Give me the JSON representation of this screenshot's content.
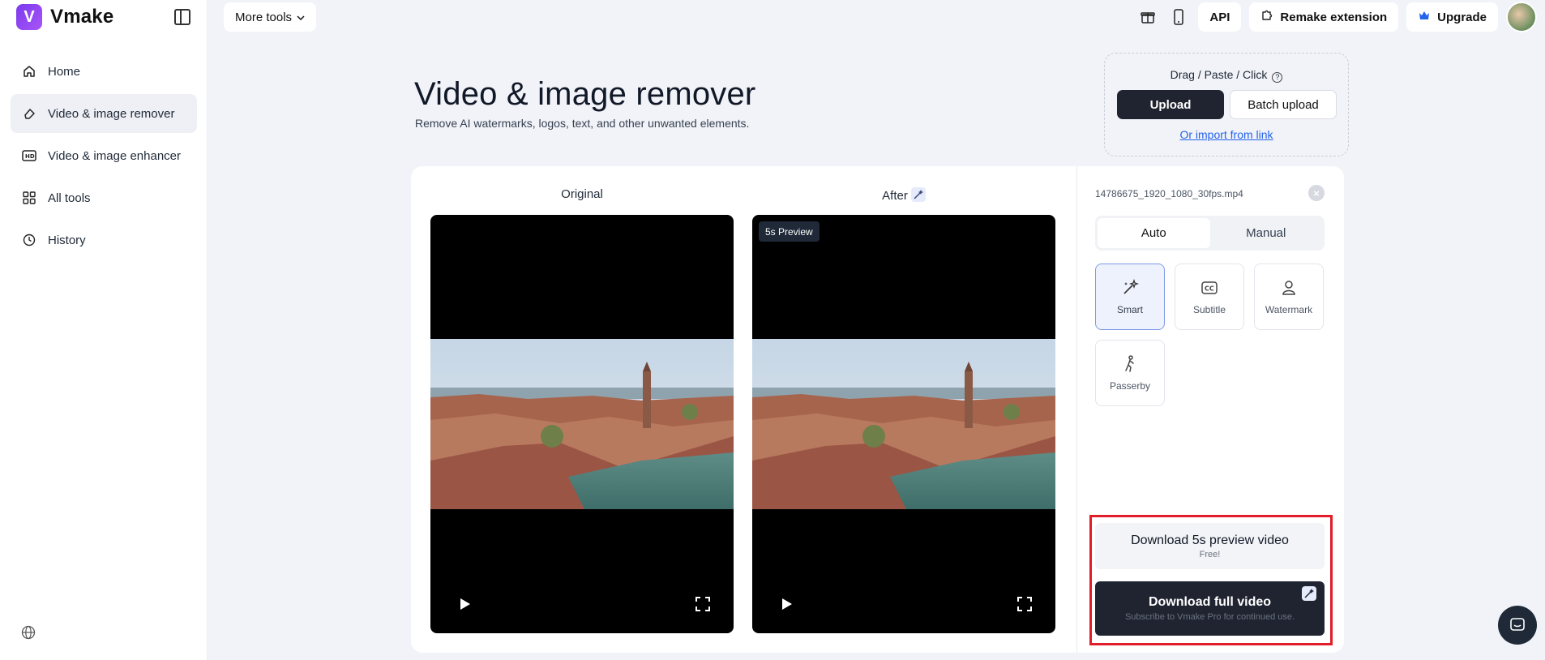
{
  "app": {
    "name": "Vmake"
  },
  "sidebar": {
    "items": [
      {
        "label": "Home",
        "icon": "home-icon",
        "active": false
      },
      {
        "label": "Video & image remover",
        "icon": "eraser-icon",
        "active": true
      },
      {
        "label": "Video & image enhancer",
        "icon": "hd-icon",
        "active": false
      },
      {
        "label": "All tools",
        "icon": "grid-icon",
        "active": false
      },
      {
        "label": "History",
        "icon": "clock-icon",
        "active": false
      }
    ]
  },
  "topbar": {
    "more_tools": "More tools",
    "api": "API",
    "remake_extension": "Remake extension",
    "upgrade": "Upgrade"
  },
  "header": {
    "title": "Video & image remover",
    "subtitle": "Remove AI watermarks, logos, text, and other unwanted elements."
  },
  "upload": {
    "hint": "Drag / Paste / Click",
    "upload_label": "Upload",
    "batch_label": "Batch upload",
    "import_link": "Or import from link"
  },
  "compare": {
    "original_label": "Original",
    "after_label": "After",
    "preview_badge": "5s Preview"
  },
  "panel": {
    "file_name": "14786675_1920_1080_30fps.mp4",
    "tabs": [
      "Auto",
      "Manual"
    ],
    "active_tab": "Auto",
    "modes": [
      {
        "label": "Smart",
        "icon": "magic-wand-icon",
        "active": true
      },
      {
        "label": "Subtitle",
        "icon": "cc-icon",
        "active": false
      },
      {
        "label": "Watermark",
        "icon": "watermark-icon",
        "active": false
      },
      {
        "label": "Passerby",
        "icon": "person-walking-icon",
        "active": false
      }
    ],
    "download_preview": {
      "title": "Download 5s preview video",
      "sub": "Free!"
    },
    "download_full": {
      "title": "Download full video",
      "sub": "Subscribe to Vmake Pro for continued use."
    }
  },
  "colors": {
    "accent_dark": "#1f2430",
    "link": "#2563eb",
    "highlight": "#e11d2a",
    "active_mode_border": "#7e9ae6"
  }
}
